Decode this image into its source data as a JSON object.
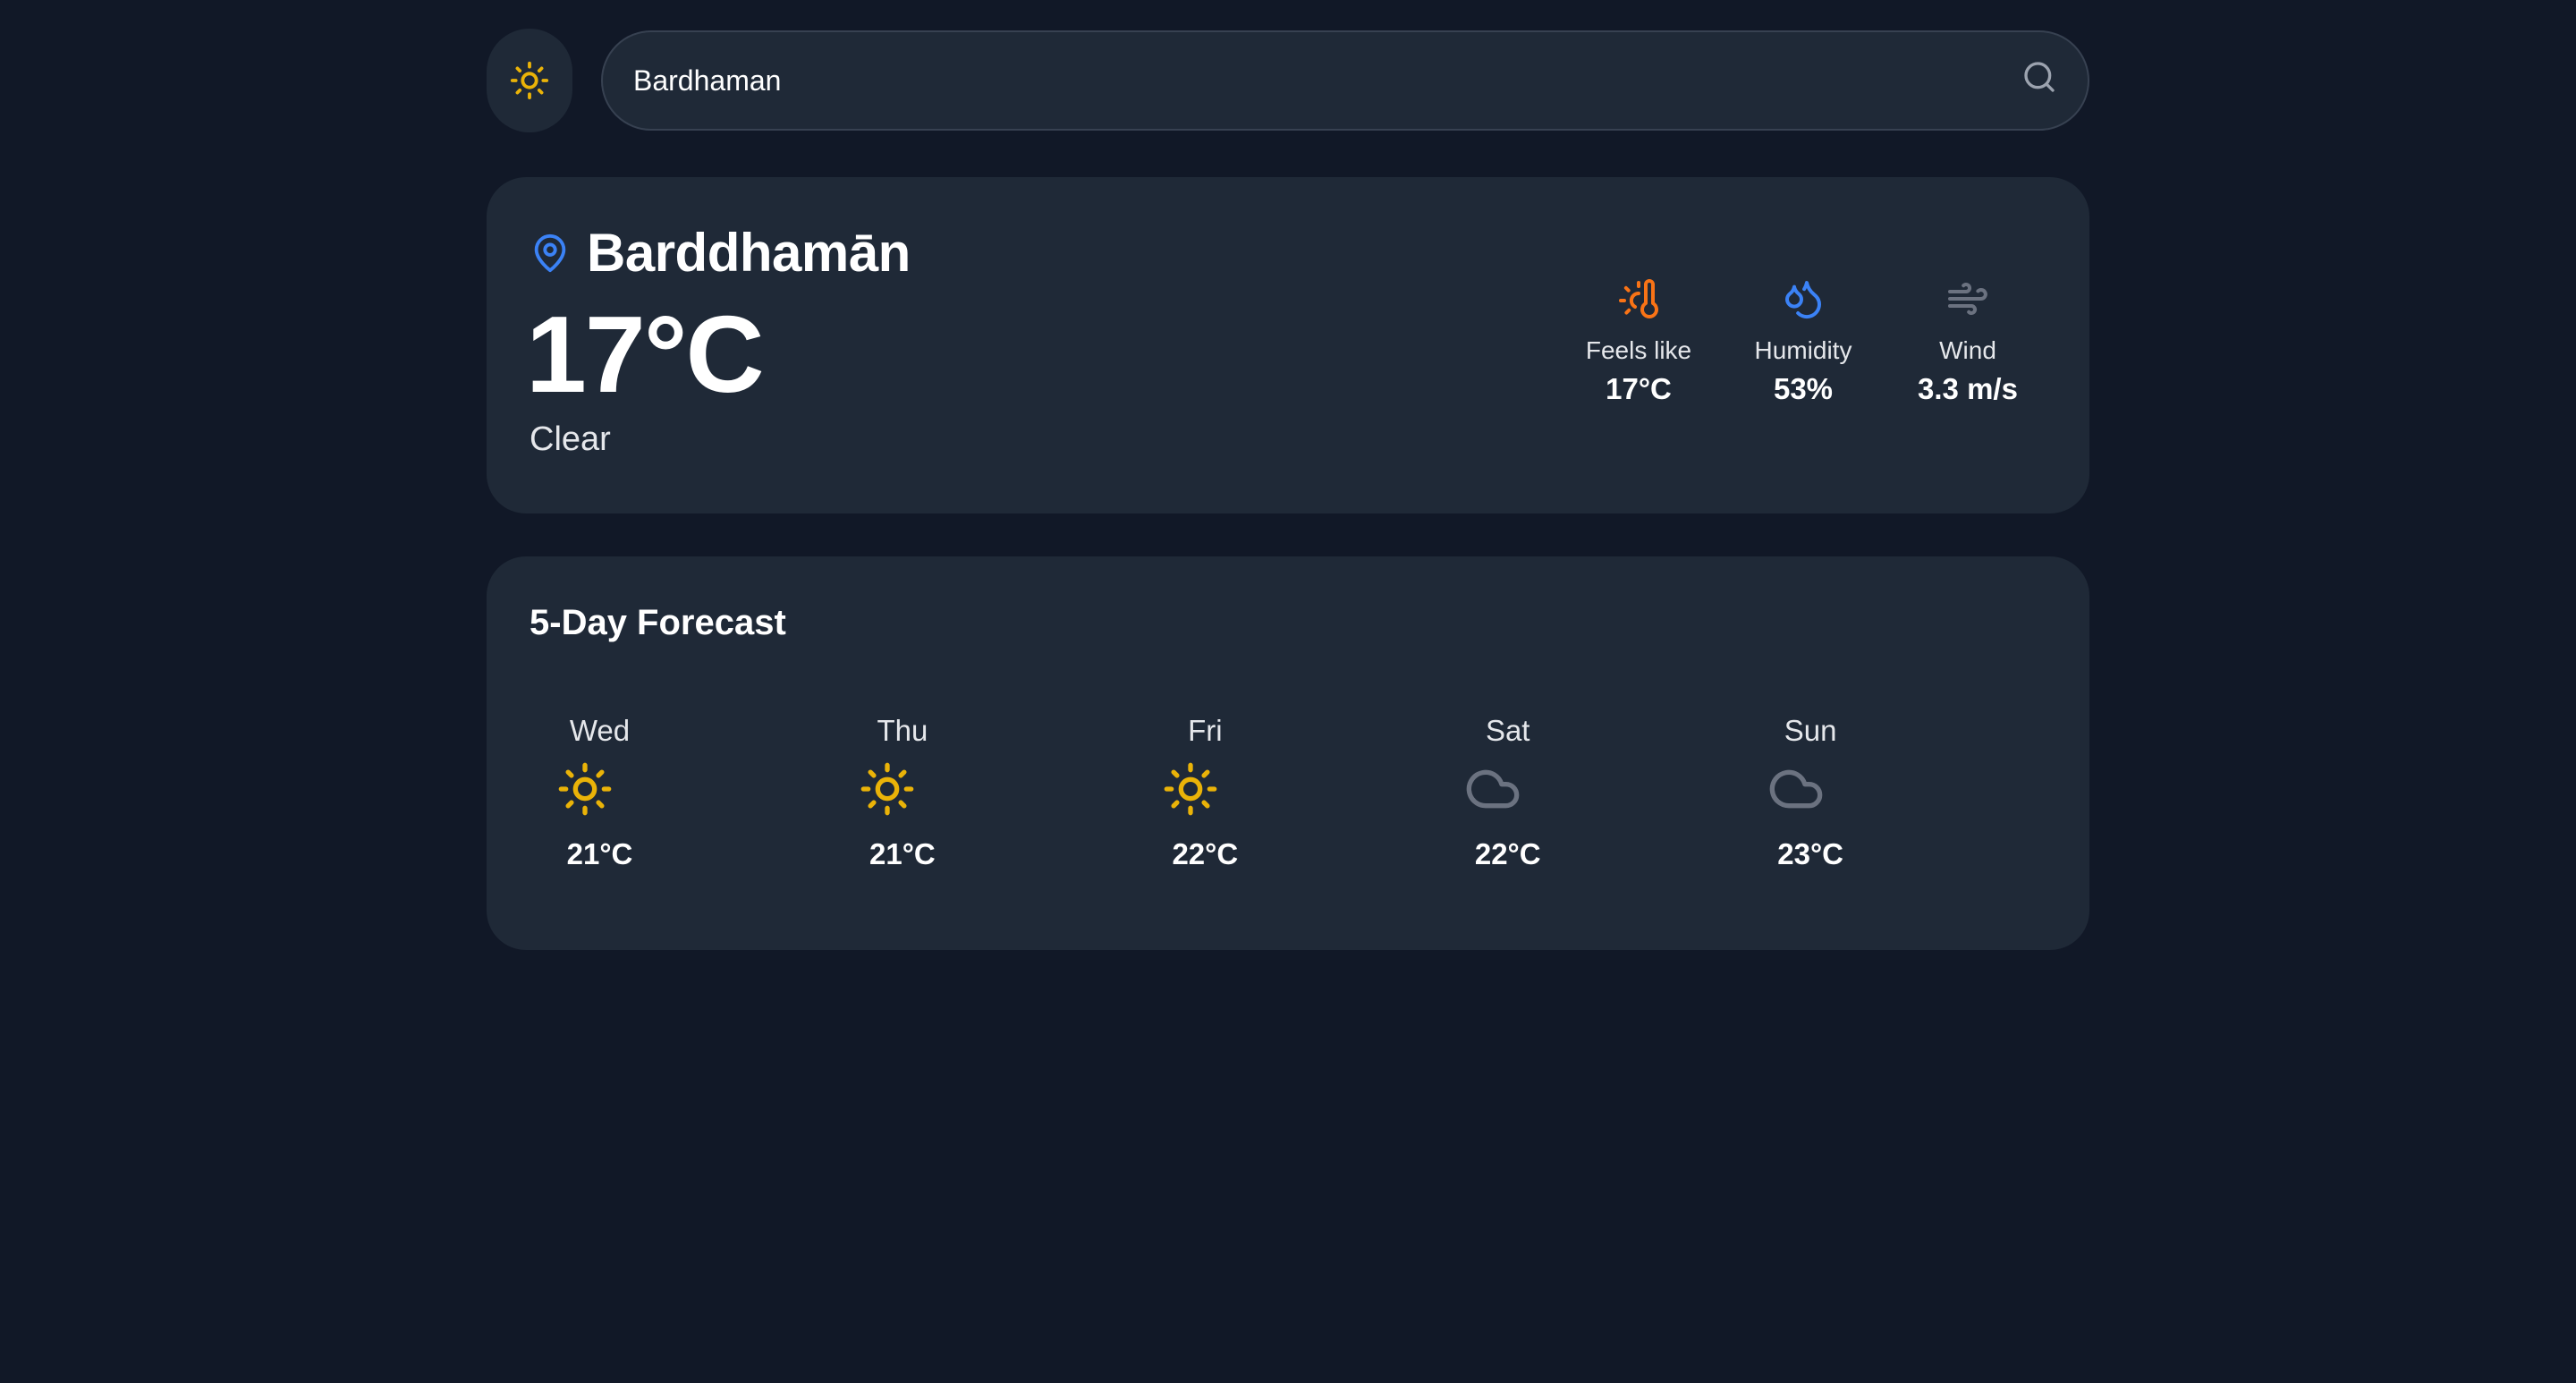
{
  "theme_toggle": {
    "icon": "sun-icon"
  },
  "search": {
    "value": "Bardhaman",
    "icon": "search-icon"
  },
  "current": {
    "location_icon": "map-pin-icon",
    "location": "Barddhamān",
    "temperature": "17°C",
    "condition": "Clear",
    "stats": [
      {
        "icon": "thermometer-sun-icon",
        "label": "Feels like",
        "value": "17°C",
        "color": "#f97316"
      },
      {
        "icon": "droplets-icon",
        "label": "Humidity",
        "value": "53%",
        "color": "#3b82f6"
      },
      {
        "icon": "wind-icon",
        "label": "Wind",
        "value": "3.3 m/s",
        "color": "#6b7280"
      }
    ]
  },
  "forecast": {
    "title": "5-Day Forecast",
    "days": [
      {
        "day": "Wed",
        "icon": "sun-icon",
        "temp": "21°C"
      },
      {
        "day": "Thu",
        "icon": "sun-icon",
        "temp": "21°C"
      },
      {
        "day": "Fri",
        "icon": "sun-icon",
        "temp": "22°C"
      },
      {
        "day": "Sat",
        "icon": "cloud-icon",
        "temp": "22°C"
      },
      {
        "day": "Sun",
        "icon": "cloud-icon",
        "temp": "23°C"
      }
    ]
  },
  "colors": {
    "background": "#111827",
    "card": "#1f2937",
    "sun": "#eab308",
    "cloud": "#6b7280",
    "pin": "#3b82f6"
  }
}
